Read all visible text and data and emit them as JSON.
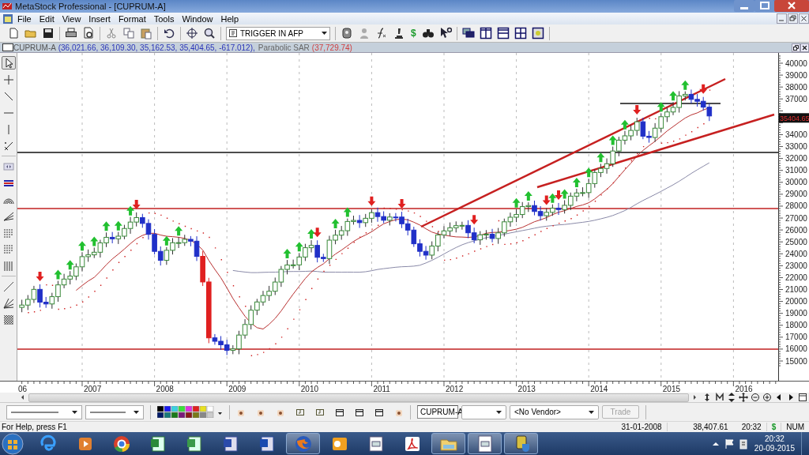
{
  "window": {
    "title": "MetaStock Professional - [CUPRUM-A]"
  },
  "menu": [
    "File",
    "Edit",
    "View",
    "Insert",
    "Format",
    "Tools",
    "Window",
    "Help"
  ],
  "toolbar": {
    "expert_dropdown": "TRIGGER IN AFP",
    "dollar_button": "$"
  },
  "drawing_tools": [
    {
      "selected": true
    },
    {
      "selected": false
    },
    {
      "selected": false
    },
    {
      "selected": false
    },
    {
      "selected": false
    },
    {
      "selected": false
    },
    {
      "selected": false
    },
    {
      "selected": false
    },
    {
      "selected": false
    },
    {
      "selected": false
    },
    {
      "selected": false
    },
    {
      "selected": false
    },
    {
      "selected": false
    },
    {
      "selected": false
    },
    {
      "selected": false
    },
    {
      "selected": false
    }
  ],
  "chart": {
    "security": "CUPRUM-A",
    "values": "(36,021.66, 36,109.30, 35,162.53, 35,404.65, -617.012),",
    "indicator": "Parabolic SAR",
    "indicator_value": "(37,729.74)",
    "y_axis_labels": [
      "40000",
      "39000",
      "38000",
      "37000",
      "34000",
      "33000",
      "32000",
      "31000",
      "30000",
      "29000",
      "28000",
      "27000",
      "26000",
      "25000",
      "24000",
      "23000",
      "22000",
      "21000",
      "20000",
      "19000",
      "18000",
      "17000",
      "16000",
      "15000"
    ],
    "x_axis_labels": [
      "06",
      "2007",
      "2008",
      "2009",
      "2010",
      "2011",
      "2012",
      "2013",
      "2014",
      "2015",
      "2016"
    ],
    "last_price_label": "35404.65"
  },
  "bottom_toolbar": {
    "security_field": "CUPRUM-A",
    "vendor_dropdown": "<No Vendor>",
    "trade_button": {
      "label": "Trade",
      "disabled": true
    }
  },
  "status_bar": {
    "help": "For Help, press F1",
    "date": "31-01-2008",
    "value": "38,407.61",
    "time": "20:32",
    "currency": "$",
    "num_lock": "NUM"
  },
  "taskbar": {
    "apps": [
      {
        "active": false
      },
      {
        "active": false
      },
      {
        "active": false
      },
      {
        "active": false
      },
      {
        "active": false
      },
      {
        "active": false
      },
      {
        "active": false
      },
      {
        "active": true
      },
      {
        "active": false
      },
      {
        "active": false
      },
      {
        "active": false
      },
      {
        "active": true
      },
      {
        "active": true
      },
      {
        "active": true
      }
    ],
    "clock_time": "20:32",
    "clock_date": "20-09-2015"
  }
}
